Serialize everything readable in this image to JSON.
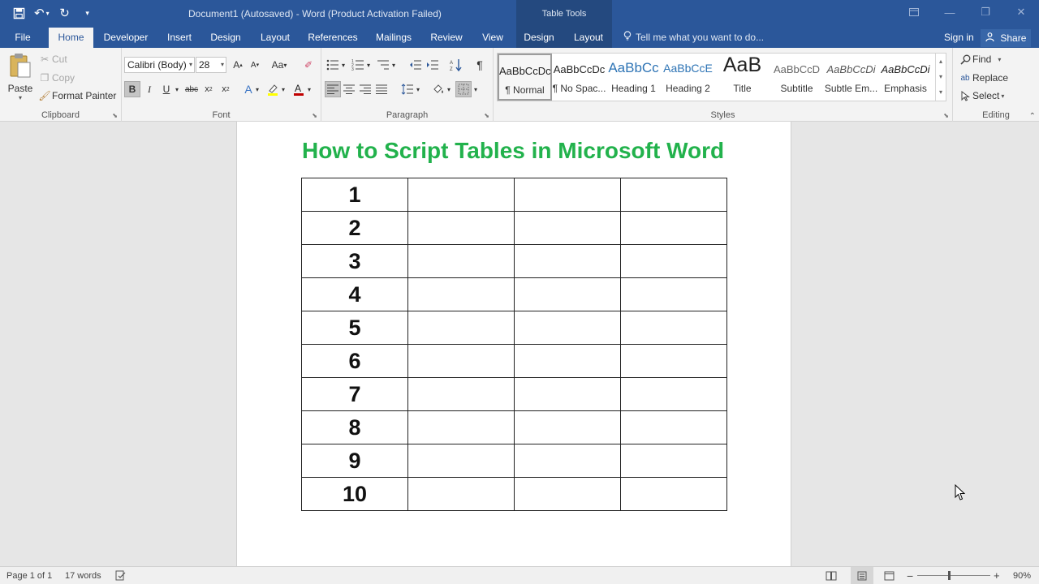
{
  "titlebar": {
    "doc_title": "Document1 (Autosaved) - Word (Product Activation Failed)",
    "contextual_title": "Table Tools"
  },
  "tabs": [
    "File",
    "Home",
    "Developer",
    "Insert",
    "Design",
    "Layout",
    "References",
    "Mailings",
    "Review",
    "View",
    "Design",
    "Layout"
  ],
  "active_tab": "Home",
  "tell_me": "Tell me what you want to do...",
  "sign_in": "Sign in",
  "share": "Share",
  "clipboard": {
    "paste": "Paste",
    "cut": "Cut",
    "copy": "Copy",
    "format_painter": "Format Painter",
    "label": "Clipboard"
  },
  "font": {
    "name": "Calibri (Body)",
    "size": "28",
    "label": "Font"
  },
  "paragraph": {
    "label": "Paragraph"
  },
  "styles": {
    "label": "Styles",
    "items": [
      {
        "preview": "AaBbCcDc",
        "name": "¶ Normal"
      },
      {
        "preview": "AaBbCcDc",
        "name": "¶ No Spac..."
      },
      {
        "preview": "AaBbCc",
        "name": "Heading 1"
      },
      {
        "preview": "AaBbCcE",
        "name": "Heading 2"
      },
      {
        "preview": "AaB",
        "name": "Title"
      },
      {
        "preview": "AaBbCcD",
        "name": "Subtitle"
      },
      {
        "preview": "AaBbCcDi",
        "name": "Subtle Em..."
      },
      {
        "preview": "AaBbCcDi",
        "name": "Emphasis"
      }
    ]
  },
  "editing": {
    "find": "Find",
    "replace": "Replace",
    "select": "Select",
    "label": "Editing"
  },
  "document": {
    "heading": "How to Script Tables in Microsoft Word",
    "rows": [
      "1",
      "2",
      "3",
      "4",
      "5",
      "6",
      "7",
      "8",
      "9",
      "10"
    ]
  },
  "status": {
    "page": "Page 1 of 1",
    "words": "17 words",
    "zoom": "90%"
  },
  "colors": {
    "brand": "#2b579a",
    "heading": "#22b24c"
  }
}
